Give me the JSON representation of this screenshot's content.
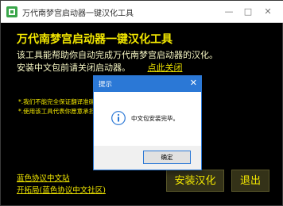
{
  "window": {
    "title": "万代南梦宫启动器一键汉化工具",
    "minimize_glyph": "—",
    "maximize_glyph": "□",
    "close_glyph": "✕"
  },
  "main": {
    "heading": "万代南梦宫启动器一键汉化工具",
    "desc_line1": "该工具能帮助你自动完成万代南梦宫启动器的汉化。",
    "desc_line2": "安装中文包前请关闭启动器。",
    "close_link": "点此关闭",
    "note1": "*.我们不能完全保证翻译准确",
    "note2": "*.使用该工具代表你愿意承担风险"
  },
  "footer": {
    "link1": "蓝色协议中文站",
    "link2": "开拓局(蓝色协议中文社区)",
    "install_button": "安装汉化",
    "exit_button": "退出"
  },
  "dialog": {
    "title": "提示",
    "close_glyph": "✕",
    "message": "中文包安装完毕。",
    "ok_button": "确定"
  },
  "colors": {
    "accent_yellow": "#f2e700",
    "background": "#000000",
    "dialog_blue": "#2b78d6"
  }
}
